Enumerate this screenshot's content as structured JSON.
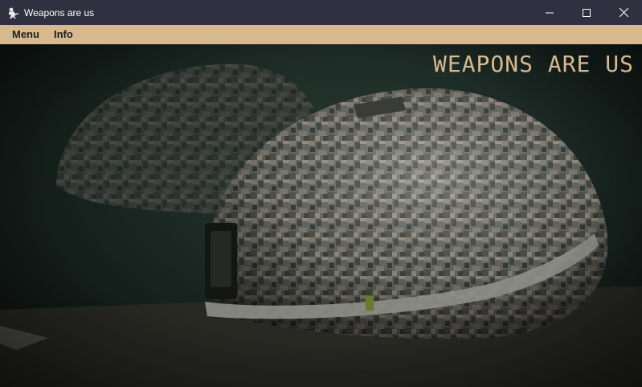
{
  "window": {
    "title": "Weapons are us",
    "controls": {
      "minimize": "minimize-icon",
      "maximize": "maximize-icon",
      "close": "close-icon"
    }
  },
  "menubar": {
    "items": [
      {
        "label": "Menu"
      },
      {
        "label": "Info"
      }
    ]
  },
  "hero": {
    "heading": "WEAPONS ARE US",
    "image": "camouflage-helmets-photo"
  },
  "colors": {
    "titlebar": "#2f3141",
    "menubar": "#d6b98c",
    "heading": "#d6b98c",
    "background": "#16221e"
  }
}
